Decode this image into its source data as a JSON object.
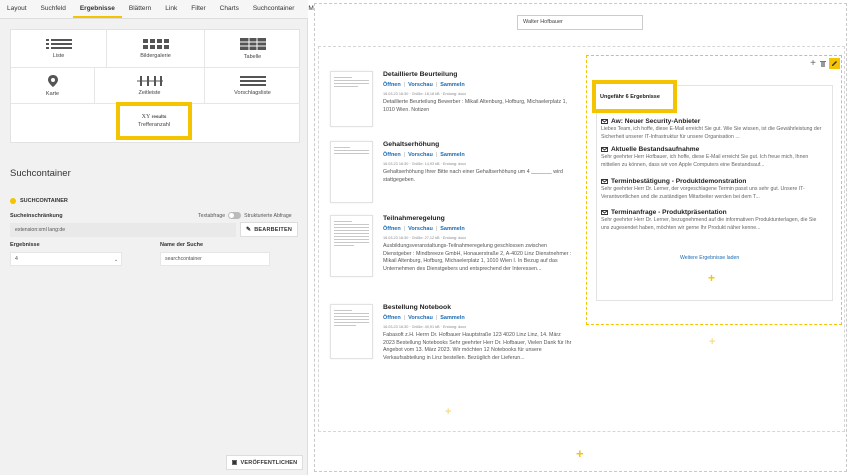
{
  "tabs": [
    "Layout",
    "Suchfeld",
    "Ergebnisse",
    "Blättern",
    "Link",
    "Filter",
    "Charts",
    "Suchcontainer",
    "Mehr"
  ],
  "active_tab": "Ergebnisse",
  "views": {
    "liste": "Liste",
    "bildergalerie": "Bildergalerie",
    "tabelle": "Tabelle",
    "karte": "Karte",
    "zeitleiste": "Zeitleiste",
    "vorschlagsliste": "Vorschlagsliste",
    "treffer_top_number": "XY",
    "treffer_top_word": "results",
    "trefferanzahl": "Trefferanzahl"
  },
  "suchcontainer": {
    "section_title": "Suchcontainer",
    "header": "SUCHCONTAINER",
    "einschraenkung_label": "Sucheinschränkung",
    "textabfrage_label": "Textabfrage",
    "strukturierte_label": "Strukturierte Abfrage",
    "einschraenkung_value": "extension:xml lang:de",
    "bearbeiten_label": "BEARBEITEN",
    "ergebnisse_label": "Ergebnisse",
    "ergebnisse_value": "4",
    "name_label": "Name der Suche",
    "name_value": "searchcontainer",
    "publish_label": "VERÖFFENTLICHEN"
  },
  "search_value": "Walter Hofbauer",
  "actions": {
    "open": "Öffnen",
    "preview": "Vorschau",
    "collect": "Sammeln"
  },
  "results": [
    {
      "title": "Detaillierte Beurteilung",
      "meta": "16.03.23 16:30 · Größe: 18,18 kB · Endung: docx",
      "snippet": "Detaillierte Beurteilung Bewerber : Mikail Altenburg, Hofburg, Michaelerplatz 1, 1010 Wien. Notizen"
    },
    {
      "title": "Gehaltserhöhung",
      "meta": "16.03.23 16:30 · Größe: 14,93 kB · Endung: docx",
      "snippet": "Gehaltserhöhung Ihrer Bitte nach einer Gehaltserhöhung um 4 _______ wird stattgegeben."
    },
    {
      "title": "Teilnahmeregelung",
      "meta": "16.03.23 16:30 · Größe: 27,12 kB · Endung: docx",
      "snippet": "Ausbildungsveranstaltungs-Teilnahmeregelung geschlossen zwischen Dienstgeber : Mindbreeze GmbH, Honauerstraße 2, A-4020 Linz Dienstnehmer : Mikail Altenburg, Hofburg, Michaelerplatz 1, 1010 Wien I. In Bezug auf das Unternehmen des Dienstgebers und entsprechend der Interessen..."
    },
    {
      "title": "Bestellung Notebook",
      "meta": "16.03.23 16:30 · Größe: 40,91 kB · Endung: docx",
      "snippet": "Fabasoft z.H. Herrn Dr. Hofbauer Hauptstraße 123 4020 Linz Linz, 14. März 2023 Bestellung Notebooks Sehr geehrter Herr Dr. Hofbauer, Vielen Dank für Ihr Angebot vom 13. März 2023. Wir möchten 12 Notebooks für unsere Verkaufsabteilung in Linz bestellen. Bezüglich der Lieferun..."
    }
  ],
  "hit_count": "Ungefähr 6 Ergebnisse",
  "suggestions": [
    {
      "title": "Aw: Neuer Security-Anbieter",
      "snippet": "Liebes Team, ich hoffe, diese E-Mail erreicht Sie gut. Wie Sie wissen, ist die Gewährleistung der Sicherheit unserer IT-Infrastruktur für unsere Organisation ..."
    },
    {
      "title": "Aktuelle Bestandsaufnahme",
      "snippet": "Sehr geehrter Herr Hofbauer, ich hoffe, diese E-Mail erreicht Sie gut. Ich freue mich, Ihnen mitteilen zu können, dass wir von Apple Computers eine Bestandsauf..."
    },
    {
      "title": "Terminbestätigung - Produktdemonstration",
      "snippet": "Sehr geehrter Herr Dr. Lerner, der vorgeschlagene Termin passt uns sehr gut. Unsere IT-Verantwortlichen und die zuständigen Mitarbeiter werden bei dem T..."
    },
    {
      "title": "Terminanfrage - Produktpräsentation",
      "snippet": "Sehr geehrter Herr Dr. Lerner, bezugnehmend auf die informativen Produktunterlagen, die Sie uns zugesendet haben, möchten wir gerne Ihr Produkt näher kenne..."
    }
  ],
  "more_results": "Weitere Ergebnisse laden",
  "colors": {
    "accent": "#f5c400",
    "link": "#1a6bb5"
  }
}
